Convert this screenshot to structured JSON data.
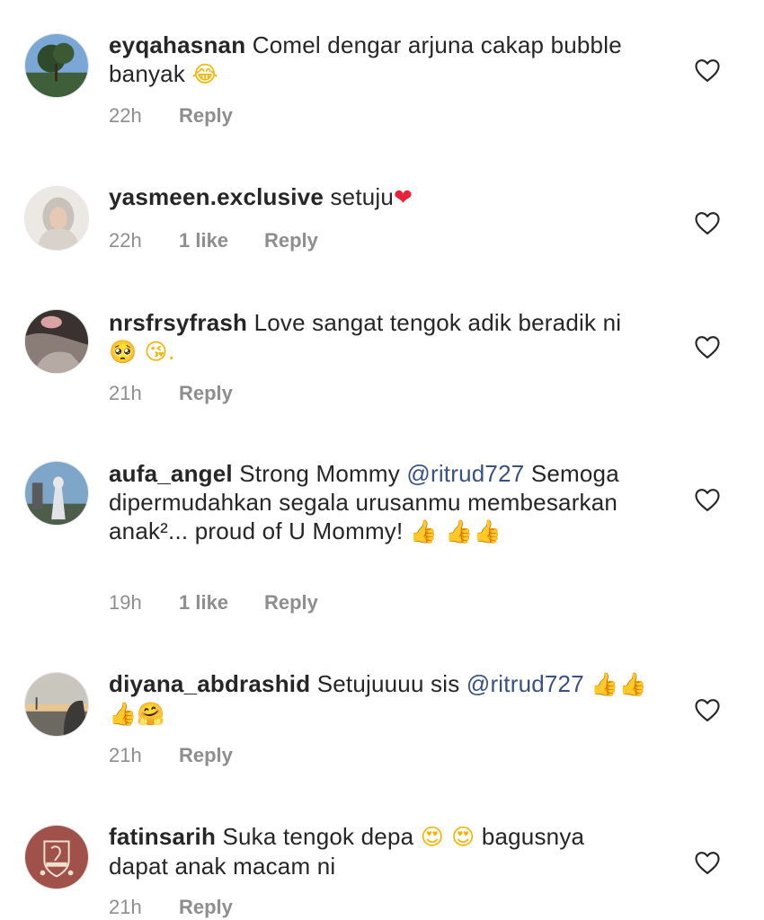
{
  "comments": [
    {
      "username": "eyqahasnan",
      "text": "Comel dengar arjuna cakap bubble banyak",
      "emoji_after": "😂",
      "time": "22h",
      "likes": "",
      "reply_label": "Reply"
    },
    {
      "username": "yasmeen.exclusive",
      "text": "setuju",
      "emoji_after": "❤",
      "time": "22h",
      "likes": "1 like",
      "reply_label": "Reply"
    },
    {
      "username": "nrsfrsyfrash",
      "text": "Love sangat tengok adik beradik ni",
      "emoji_after": "🥺 😘.",
      "time": "21h",
      "likes": "",
      "reply_label": "Reply"
    },
    {
      "username": "aufa_angel",
      "text_before": "Strong Mommy",
      "mention": "@ritrud727",
      "text_after": "Semoga dipermudahkan segala urusanmu membesarkan anak²... proud of U Mommy!",
      "emoji_after": "👍 👍👍",
      "time": "19h",
      "likes": "1 like",
      "reply_label": "Reply"
    },
    {
      "username": "diyana_abdrashid",
      "text_before": "Setujuuuu sis",
      "mention": "@ritrud727",
      "emoji_after": "👍👍👍🤗",
      "time": "21h",
      "likes": "",
      "reply_label": "Reply"
    },
    {
      "username": "fatinsarih",
      "text_before": "Suka tengok depa",
      "emoji_mid": "😍 😍",
      "text_after": "bagusnya dapat anak macam ni",
      "time": "21h",
      "likes": "",
      "reply_label": "Reply"
    }
  ],
  "icons": {
    "like": "heart-outline-icon"
  },
  "colors": {
    "mention": "#385185",
    "meta": "#8e8e8e",
    "text": "#262626"
  }
}
